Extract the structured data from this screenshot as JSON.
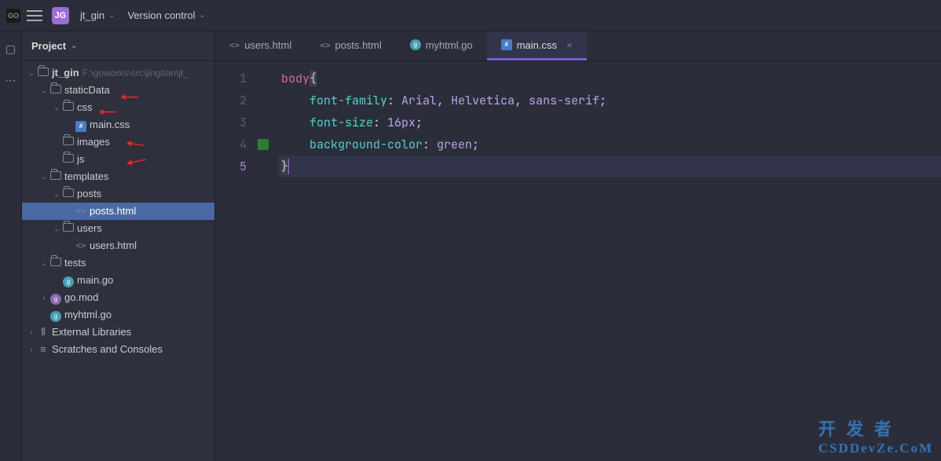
{
  "top": {
    "project_badge": "JG",
    "project_name": "jt_gin",
    "vc_label": "Version control"
  },
  "sidebar": {
    "header": "Project",
    "root": {
      "name": "jt_gin",
      "path": "F:\\goworks\\src\\jingtian\\jt_"
    },
    "tree": {
      "staticData": "staticData",
      "css": "css",
      "main_css": "main.css",
      "images": "images",
      "js": "js",
      "templates": "templates",
      "posts": "posts",
      "posts_html": "posts.html",
      "users": "users",
      "users_html": "users.html",
      "tests": "tests",
      "main_go": "main.go",
      "go_mod": "go.mod",
      "myhtml_go": "myhtml.go",
      "ext_lib": "External Libraries",
      "scratches": "Scratches and Consoles"
    }
  },
  "tabs": [
    {
      "label": "users.html",
      "icon": "code",
      "active": false
    },
    {
      "label": "posts.html",
      "icon": "code",
      "active": false
    },
    {
      "label": "myhtml.go",
      "icon": "go",
      "active": false
    },
    {
      "label": "main.css",
      "icon": "css",
      "active": true
    }
  ],
  "editor": {
    "filename": "main.css",
    "lines": {
      "l1a": "body",
      "l1b": "{",
      "l2k": "    font-family",
      "l2v": "Arial",
      "l2v2": "Helvetica",
      "l2v3": "sans-serif",
      "l3k": "    font-size",
      "l3v": "16px",
      "l4k": "    background-color",
      "l4v": "green",
      "l5": "}"
    },
    "line_numbers": [
      "1",
      "2",
      "3",
      "4",
      "5"
    ]
  },
  "watermark": {
    "l1": "开 发 者",
    "l2": "CSDDevZe.CoM"
  }
}
